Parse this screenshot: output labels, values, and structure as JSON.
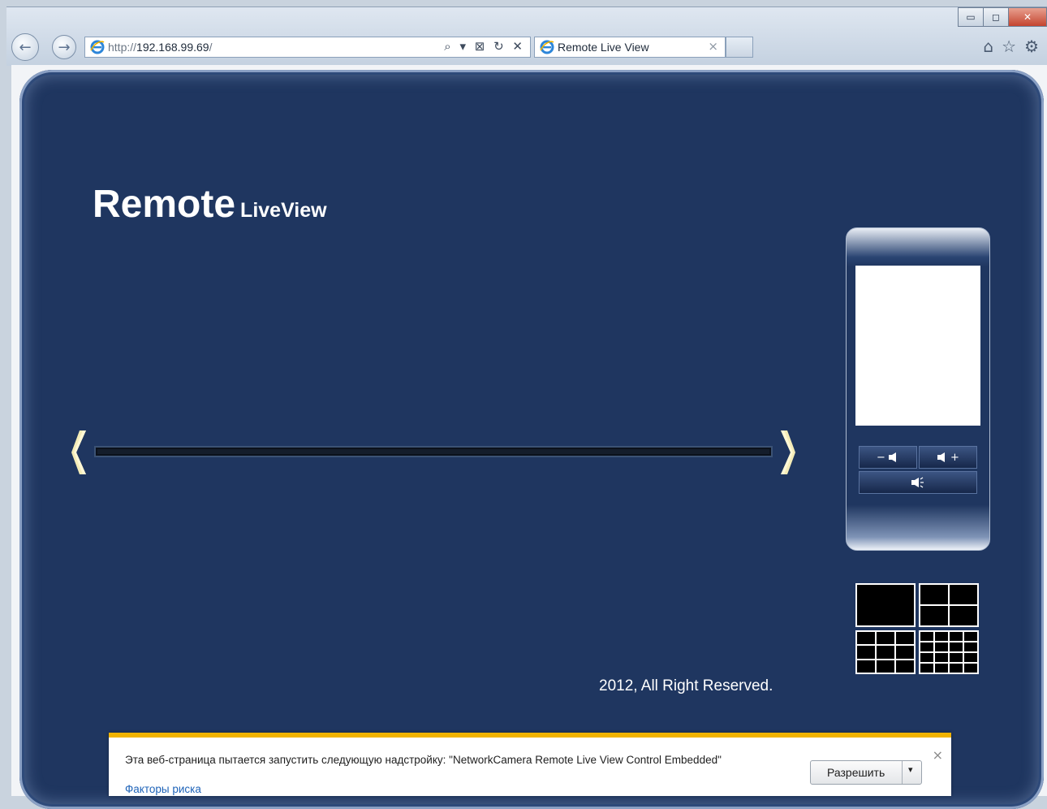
{
  "browser": {
    "address": {
      "prefix": "http://",
      "host": "192.168.99.69",
      "suffix": "/"
    },
    "address_tools": "⌕ ▾ ⊠ ↻ ✕",
    "tab": {
      "title": "Remote Live View",
      "close": "×"
    },
    "window_buttons": {
      "minimize": "▭",
      "maximize": "◻",
      "close": "✕"
    },
    "right_icons": [
      "home-icon",
      "favorites-star-icon",
      "tools-gear-icon"
    ]
  },
  "page": {
    "brand": {
      "title": "Remote",
      "subtitle": "LiveView"
    },
    "copyright": "2012, All Right Reserved.",
    "side_controls": {
      "volume_down": "−",
      "volume_up": "+",
      "layouts": [
        "1",
        "4",
        "9",
        "16"
      ]
    },
    "colors": {
      "panel": "#1f3660",
      "arrow": "#f4ecb8",
      "notify_accent": "#f1b300"
    }
  },
  "notification": {
    "message": "Эта веб-страница пытается запустить следующую надстройку: \"NetworkCamera Remote Live View Control Embedded\"",
    "risk_link": "Факторы риска",
    "allow_button": "Разрешить",
    "dropdown_caret": "▾",
    "close": "×"
  }
}
